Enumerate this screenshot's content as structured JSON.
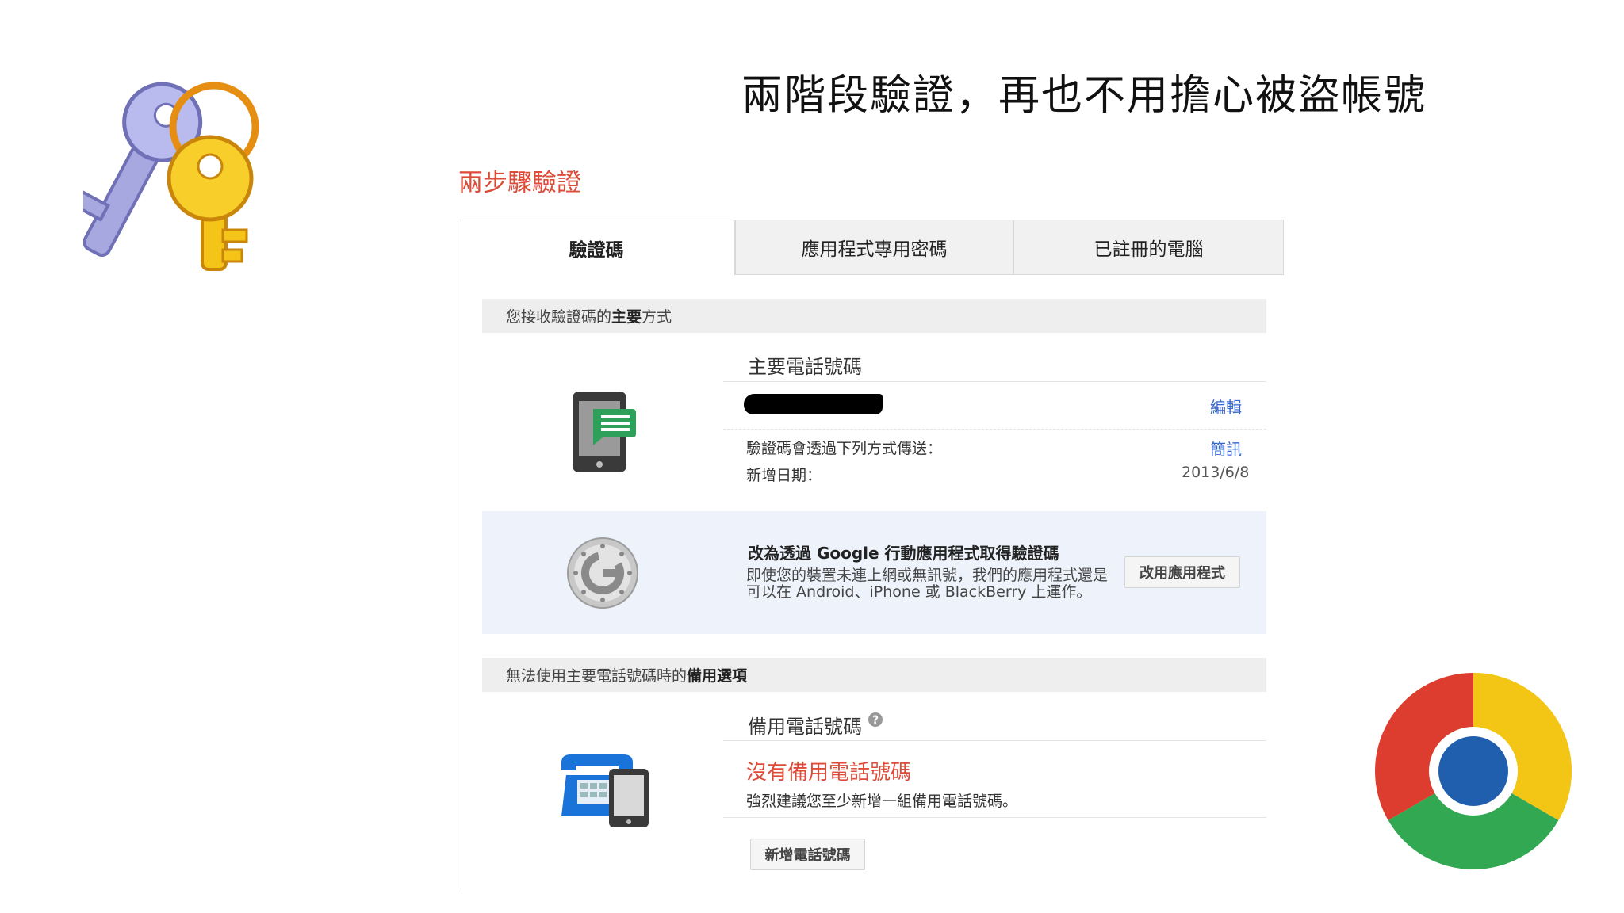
{
  "slide": {
    "title": "兩階段驗證，再也不用擔心被盜帳號"
  },
  "page": {
    "section_title": "兩步驟驗證"
  },
  "tabs": [
    {
      "label": "驗證碼",
      "active": true
    },
    {
      "label": "應用程式專用密碼",
      "active": false
    },
    {
      "label": "已註冊的電腦",
      "active": false
    }
  ],
  "primary": {
    "header_prefix": "您接收驗證碼的",
    "header_bold": "主要",
    "header_suffix": "方式",
    "phone_title": "主要電話號碼",
    "edit_link": "編輯",
    "delivery_label": "驗證碼會透過下列方式傳送：",
    "delivery_value": "簡訊",
    "added_label": "新增日期：",
    "added_value": "2013/6/8"
  },
  "promo": {
    "title": "改為透過 Google 行動應用程式取得驗證碼",
    "description": "即使您的裝置未連上網或無訊號，我們的應用程式還是可以在 Android、iPhone 或 BlackBerry 上運作。",
    "button": "改用應用程式"
  },
  "backup": {
    "header_prefix": "無法使用主要電話號碼時的",
    "header_bold": "備用選項",
    "title": "備用電話號碼",
    "empty_title": "沒有備用電話號碼",
    "recommendation": "強烈建議您至少新增一組備用電話號碼。",
    "add_button": "新增電話號碼"
  },
  "icons": {
    "keys": "keys-icon",
    "chrome": "chrome-logo",
    "phone_sms": "phone-sms-icon",
    "google": "google-g-icon",
    "help": "help-icon",
    "backup_phone": "desk-phone-icon"
  },
  "colors": {
    "accent_red": "#dd4b39",
    "link_blue": "#3366cc",
    "promo_bg": "#eef3fb"
  }
}
